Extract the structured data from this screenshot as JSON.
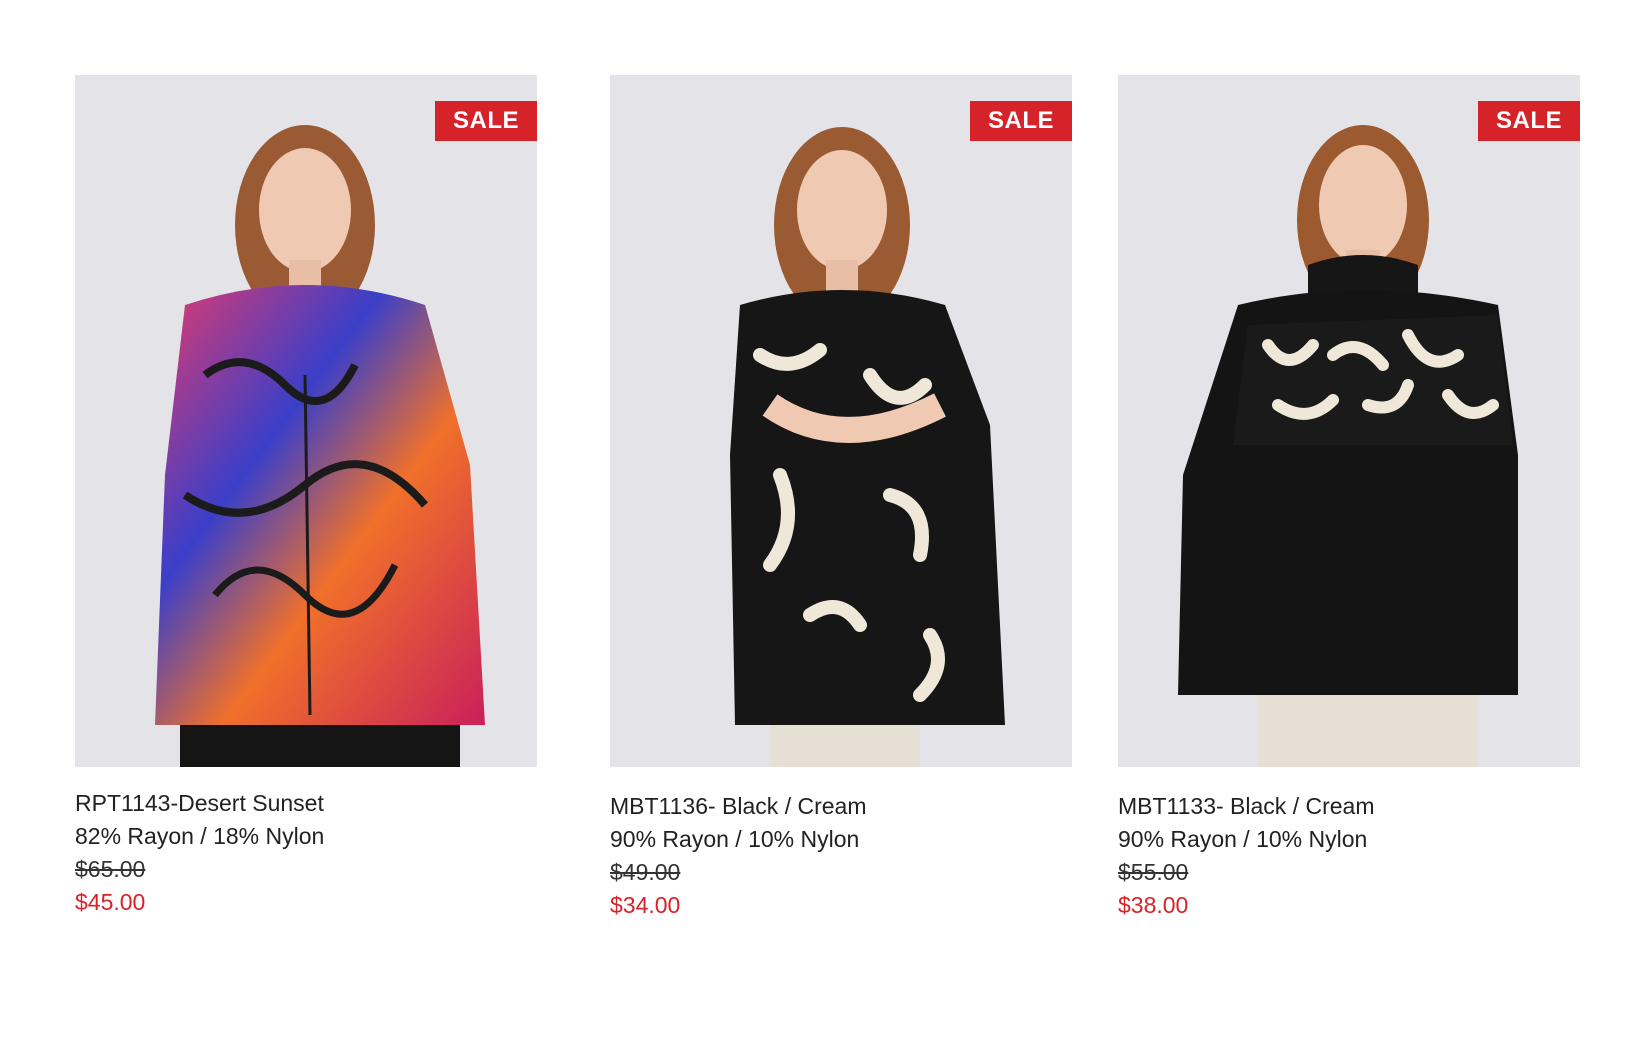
{
  "colors": {
    "sale_red": "#d6232a",
    "image_bg": "#e4e4e8",
    "text": "#222222"
  },
  "products": [
    {
      "badge": "SALE",
      "title": "RPT1143-Desert Sunset",
      "material": "82% Rayon / 18% Nylon",
      "price_original": "$65.00",
      "price_sale": "$45.00",
      "image_icon": "model-photo-multicolor-shirt"
    },
    {
      "badge": "SALE",
      "title": "MBT1136- Black / Cream",
      "material": "90% Rayon / 10% Nylon",
      "price_original": "$49.00",
      "price_sale": "$34.00",
      "image_icon": "model-photo-black-cream-tunic"
    },
    {
      "badge": "SALE",
      "title": "MBT1133- Black / Cream",
      "material": "90% Rayon / 10% Nylon",
      "price_original": "$55.00",
      "price_sale": "$38.00",
      "image_icon": "model-photo-black-poncho-top"
    }
  ]
}
